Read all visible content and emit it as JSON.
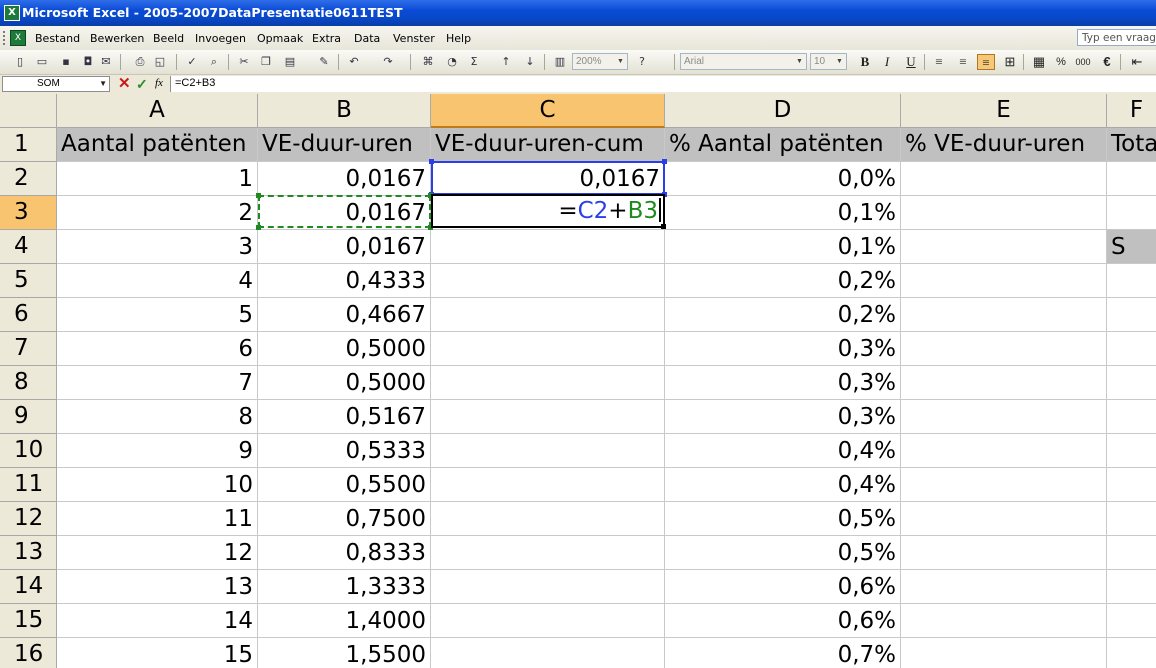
{
  "window": {
    "title": "Microsoft Excel - 2005-2007DataPresentatie0611TEST",
    "app_icon": "excel-icon"
  },
  "menu": {
    "items": [
      "Bestand",
      "Bewerken",
      "Beeld",
      "Invoegen",
      "Opmaak",
      "Extra",
      "Data",
      "Venster",
      "Help"
    ],
    "ask_placeholder": "Typ een vraag"
  },
  "toolbar": {
    "zoom": "200%",
    "font_name": "Arial",
    "font_size": "10",
    "bold": "B",
    "italic": "I",
    "underline": "U",
    "sum": "Σ",
    "euro": "€",
    "percent": "%",
    "thousands": "000"
  },
  "formula_bar": {
    "name_box": "SOM",
    "fx_label": "fx",
    "cancel": "✕",
    "enter": "✓",
    "formula": "=C2+B3"
  },
  "columns": [
    "A",
    "B",
    "C",
    "D",
    "E",
    "F"
  ],
  "headers": {
    "A": "Aantal patënten",
    "B": "VE-duur-uren",
    "C": "VE-duur-uren-cum",
    "D": "% Aantal patënten",
    "E": "% VE-duur-uren",
    "F": "Tota"
  },
  "rows": [
    {
      "n": "1"
    },
    {
      "n": "2",
      "A": "1",
      "B": "0,0167",
      "C": "0,0167",
      "D": "0,0%"
    },
    {
      "n": "3",
      "A": "2",
      "B": "0,0167",
      "D": "0,1%"
    },
    {
      "n": "4",
      "A": "3",
      "B": "0,0167",
      "D": "0,1%",
      "F": "S"
    },
    {
      "n": "5",
      "A": "4",
      "B": "0,4333",
      "D": "0,2%"
    },
    {
      "n": "6",
      "A": "5",
      "B": "0,4667",
      "D": "0,2%"
    },
    {
      "n": "7",
      "A": "6",
      "B": "0,5000",
      "D": "0,3%"
    },
    {
      "n": "8",
      "A": "7",
      "B": "0,5000",
      "D": "0,3%"
    },
    {
      "n": "9",
      "A": "8",
      "B": "0,5167",
      "D": "0,3%"
    },
    {
      "n": "10",
      "A": "9",
      "B": "0,5333",
      "D": "0,4%"
    },
    {
      "n": "11",
      "A": "10",
      "B": "0,5500",
      "D": "0,4%"
    },
    {
      "n": "12",
      "A": "11",
      "B": "0,7500",
      "D": "0,5%"
    },
    {
      "n": "13",
      "A": "12",
      "B": "0,8333",
      "D": "0,5%"
    },
    {
      "n": "14",
      "A": "13",
      "B": "1,3333",
      "D": "0,6%"
    },
    {
      "n": "15",
      "A": "14",
      "B": "1,4000",
      "D": "0,6%"
    },
    {
      "n": "16",
      "A": "15",
      "B": "1,5500",
      "D": "0,7%"
    }
  ],
  "editing": {
    "cell": "C3",
    "prefix": "=",
    "ref1": "C2",
    "op": "+",
    "ref2": "B3"
  },
  "colors": {
    "title_bar": "#0a4bd6",
    "header_row_fill": "#c0c0c0",
    "selection_header": "#f8c470",
    "ref_blue": "#2b3ee8",
    "ref_green": "#1f8a1f"
  }
}
